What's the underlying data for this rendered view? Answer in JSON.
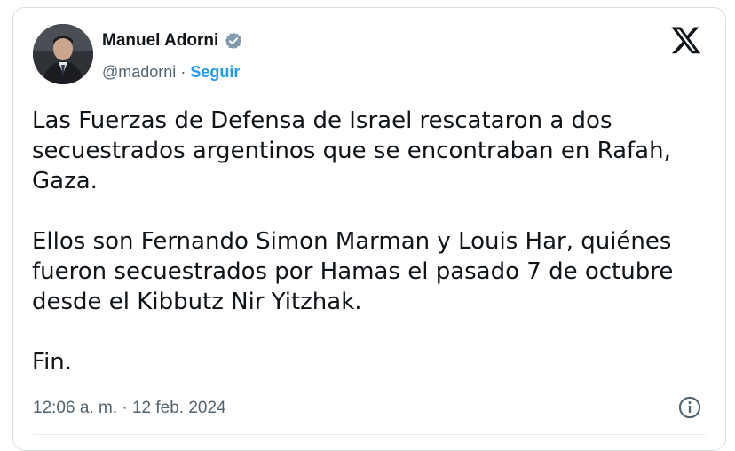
{
  "author": {
    "name": "Manuel Adorni",
    "handle": "@madorni",
    "separator": " · ",
    "follow_label": "Seguir",
    "verified_icon": "verified-badge-icon",
    "verified_color": "#829aab"
  },
  "platform_icon": "x-logo-icon",
  "tweet": {
    "paragraph_1": "Las Fuerzas de Defensa de Israel rescataron a dos secuestrados argentinos que se encontraban en Rafah, Gaza.",
    "paragraph_2": "Ellos son Fernando Simon Marman y Louis Har, quiénes fueron secuestrados por Hamas el pasado 7 de octubre desde el Kibbutz Nir Yitzhak.",
    "paragraph_3": "Fin."
  },
  "timestamp": "12:06 a. m. · 12 feb. 2024",
  "info_icon": "info-icon",
  "colors": {
    "text": "#0f1419",
    "muted": "#536471",
    "accent": "#1d9bf0"
  }
}
